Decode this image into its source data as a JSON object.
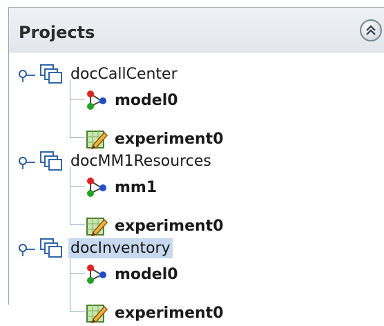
{
  "panel": {
    "title": "Projects",
    "collapse_icon": "double-chevron-up-icon"
  },
  "tree": {
    "projects": [
      {
        "name": "docCallCenter",
        "icon": "project-icon",
        "selected": false,
        "children": [
          {
            "name": "model0",
            "icon": "model-icon"
          },
          {
            "name": "experiment0",
            "icon": "experiment-icon"
          }
        ]
      },
      {
        "name": "docMM1Resources",
        "icon": "project-icon",
        "selected": false,
        "children": [
          {
            "name": "mm1",
            "icon": "model-icon"
          },
          {
            "name": "experiment0",
            "icon": "experiment-icon"
          }
        ]
      },
      {
        "name": "docInventory",
        "icon": "project-icon",
        "selected": true,
        "children": [
          {
            "name": "model0",
            "icon": "model-icon"
          },
          {
            "name": "experiment0",
            "icon": "experiment-icon"
          }
        ]
      }
    ]
  },
  "colors": {
    "selection": "#c6d9ee",
    "tree_line": "#8da4bd",
    "header_bg": "#e8ebef"
  }
}
